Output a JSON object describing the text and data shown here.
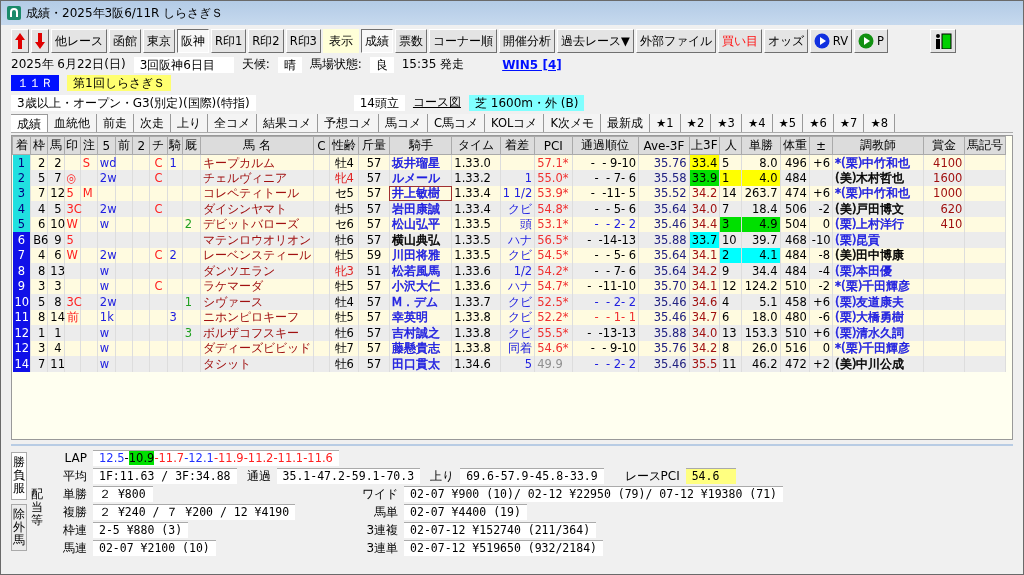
{
  "window": {
    "title": "成績・2025年3阪6/11R しらさぎＳ"
  },
  "toolbar": [
    {
      "kind": "up"
    },
    {
      "kind": "down"
    },
    {
      "kind": "button",
      "label": "他レース",
      "selected": false
    },
    {
      "kind": "button",
      "label": "函館",
      "selected": false
    },
    {
      "kind": "button",
      "label": "東京",
      "selected": false
    },
    {
      "kind": "button",
      "label": "阪神",
      "selected": true
    },
    {
      "kind": "button",
      "label": "R印1",
      "selected": false
    },
    {
      "kind": "button",
      "label": "R印2",
      "selected": false
    },
    {
      "kind": "button",
      "label": "R印3",
      "selected": false
    },
    {
      "kind": "label",
      "label": "表示"
    },
    {
      "kind": "button",
      "label": "成績",
      "selected": true
    },
    {
      "kind": "button",
      "label": "票数",
      "selected": false
    },
    {
      "kind": "button",
      "label": "コーナー順",
      "selected": false
    },
    {
      "kind": "button",
      "label": "開催分析",
      "selected": false
    },
    {
      "kind": "button",
      "label": "過去レース▼",
      "selected": false
    },
    {
      "kind": "button",
      "label": "外部ファイル",
      "selected": false
    },
    {
      "kind": "alert",
      "label": "買い目"
    },
    {
      "kind": "button",
      "label": "オッズ",
      "selected": false
    },
    {
      "kind": "play",
      "label": "RV",
      "color": "#1030e0"
    },
    {
      "kind": "play",
      "label": "P",
      "color": "#109010"
    },
    {
      "kind": "exit"
    }
  ],
  "race_info": {
    "date": "2025年 6月22日(日)",
    "meeting": "3回阪神6日目",
    "weather_label": "天候:",
    "weather": "晴",
    "track_label": "馬場状態:",
    "track": "良",
    "start": "15:35 発走",
    "win5_link": "WIN5 [4]",
    "race_number": "１１Ｒ",
    "race_name": "第1回しらさぎＳ",
    "conditions": "3歳以上・オープン・G3(別定)(国際)(特指)",
    "runners": "14頭立",
    "course_link": "コース図",
    "course": "芝 1600m・外 (B)"
  },
  "tabs": [
    {
      "label": "成績",
      "selected": true
    },
    {
      "label": "血統他",
      "selected": false
    },
    {
      "label": "前走",
      "selected": false
    },
    {
      "label": "次走",
      "selected": false
    },
    {
      "label": "上り",
      "selected": false
    },
    {
      "label": "全コメ",
      "selected": false
    },
    {
      "label": "結果コメ",
      "selected": false
    },
    {
      "label": "予想コメ",
      "selected": false
    },
    {
      "label": "馬コメ",
      "selected": false
    },
    {
      "label": "C馬コメ",
      "selected": false
    },
    {
      "label": "KOLコメ",
      "selected": false
    },
    {
      "label": "K次メモ",
      "selected": false
    },
    {
      "label": "最新成",
      "selected": false
    },
    {
      "label": "★1",
      "selected": false
    },
    {
      "label": "★2",
      "selected": false
    },
    {
      "label": "★3",
      "selected": false
    },
    {
      "label": "★4",
      "selected": false
    },
    {
      "label": "★5",
      "selected": false
    },
    {
      "label": "★6",
      "selected": false
    },
    {
      "label": "★7",
      "selected": false
    },
    {
      "label": "★8",
      "selected": false
    }
  ],
  "table": {
    "columns": [
      "着",
      "枠",
      "馬",
      "印",
      "注",
      "5",
      "前",
      "2",
      "チ",
      "騎",
      "厩",
      "馬 名",
      "C",
      "性齢",
      "斤量",
      "騎手",
      "タイム",
      "着差",
      "PCI",
      "通過順位",
      "Ave-3F",
      "上3F",
      "人",
      "単勝",
      "体重",
      "±",
      "調教師",
      "賞金",
      "馬記号"
    ],
    "rows": [
      {
        "cells": [
          {
            "text": "1",
            "color": "#20e0e0"
          },
          "2",
          "2",
          null,
          "S",
          "wd",
          null,
          null,
          "C",
          "1",
          null,
          "キープカルム",
          null,
          {
            "text": "牡4",
            "color": "#000000"
          },
          "57",
          {
            "text": "坂井瑠星",
            "color": "#2020e0",
            "focused": false
          },
          "1.33.0",
          null,
          {
            "text": "57.1*",
            "color": "#f03030"
          },
          {
            "text": "-  - 9-10",
            "color": "#000000"
          },
          "35.76",
          {
            "text": "33.4",
            "kind": "rank1"
          },
          "5",
          "8.0",
          "496",
          "+6",
          {
            "text": "*(栗)中竹和也",
            "color": "#2020e0"
          },
          "4100",
          null
        ]
      },
      {
        "cells": [
          {
            "text": "2",
            "color": "#20e0e0"
          },
          "5",
          "7",
          "◎",
          null,
          "2w",
          null,
          null,
          "C",
          null,
          null,
          "チェルヴィニア",
          null,
          {
            "text": "牝4",
            "color": "#e02020"
          },
          "57",
          {
            "text": "ルメール",
            "color": "#2020e0",
            "focused": false
          },
          "1.33.2",
          "1",
          {
            "text": "55.0*",
            "color": "#f03030"
          },
          {
            "text": "-  - 7- 6",
            "color": "#000000"
          },
          "35.58",
          {
            "text": "33.9",
            "kind": "rank3"
          },
          {
            "text": "1",
            "kind": "rank1"
          },
          {
            "text": "4.0",
            "kind": "rank1"
          },
          "484",
          null,
          {
            "text": "(美)木村哲也",
            "color": "#000000"
          },
          "1600",
          null
        ]
      },
      {
        "cells": [
          {
            "text": "3",
            "color": "#20e0e0"
          },
          "7",
          "12",
          "5",
          "M",
          null,
          null,
          null,
          null,
          null,
          null,
          "コレペティトール",
          null,
          {
            "text": "セ5",
            "color": "#000000"
          },
          "57",
          {
            "text": "井上敏樹",
            "color": "#2020e0",
            "focused": true
          },
          "1.33.4",
          "1 1/2",
          {
            "text": "53.9*",
            "color": "#f03030"
          },
          {
            "text": "-  -11- 5",
            "color": "#000000"
          },
          "35.52",
          "34.2",
          "14",
          "263.7",
          "474",
          "+6",
          {
            "text": "*(栗)中竹和也",
            "color": "#2020e0"
          },
          "1000",
          null
        ]
      },
      {
        "cells": [
          {
            "text": "4",
            "color": "#20e0e0"
          },
          "4",
          "5",
          "3C",
          null,
          "2w",
          null,
          null,
          "C",
          null,
          null,
          "ダイシンヤマト",
          null,
          {
            "text": "牡5",
            "color": "#000000"
          },
          "57",
          {
            "text": "岩田康誠",
            "color": "#2020e0",
            "focused": false
          },
          "1.33.4",
          "クビ",
          {
            "text": "54.8*",
            "color": "#f03030"
          },
          {
            "text": "-  - 5- 6",
            "color": "#000000"
          },
          "35.64",
          "34.0",
          "7",
          "18.4",
          "506",
          "-2",
          {
            "text": "(美)戸田博文",
            "color": "#000000"
          },
          "620",
          null
        ]
      },
      {
        "cells": [
          {
            "text": "5",
            "color": "#20e0e0"
          },
          "6",
          "10",
          "W",
          null,
          "w",
          null,
          null,
          null,
          null,
          "2",
          "デビットバローズ",
          null,
          {
            "text": "セ6",
            "color": "#000000"
          },
          "57",
          {
            "text": "松山弘平",
            "color": "#2020e0",
            "focused": false
          },
          "1.33.5",
          "頭",
          {
            "text": "53.1*",
            "color": "#f03030"
          },
          {
            "text": "-  - 2- 2",
            "color": "#2020e0"
          },
          "35.46",
          "34.4",
          {
            "text": "3",
            "kind": "rank3"
          },
          {
            "text": "4.9",
            "kind": "rank3"
          },
          "504",
          "0",
          {
            "text": "(栗)上村洋行",
            "color": "#2020e0"
          },
          "410",
          null
        ]
      },
      {
        "cells": [
          {
            "text": "6",
            "color": "#1010e8"
          },
          "B6",
          "9",
          "5",
          null,
          null,
          null,
          null,
          null,
          null,
          null,
          "マテンロウオリオン",
          null,
          {
            "text": "牡6",
            "color": "#000000"
          },
          "57",
          {
            "text": "横山典弘",
            "color": "#000000",
            "focused": false
          },
          "1.33.5",
          "ハナ",
          {
            "text": "56.5*",
            "color": "#f03030"
          },
          {
            "text": "-  -14-13",
            "color": "#000000"
          },
          "35.88",
          {
            "text": "33.7",
            "kind": "rank2"
          },
          "10",
          "39.7",
          "468",
          "-10",
          {
            "text": "(栗)昆貢",
            "color": "#2020e0"
          },
          null,
          null
        ]
      },
      {
        "cells": [
          {
            "text": "7",
            "color": "#1010e8"
          },
          "4",
          "6",
          "W",
          null,
          "2w",
          null,
          null,
          "C",
          "2",
          null,
          "レーベンスティール",
          null,
          {
            "text": "牡5",
            "color": "#000000"
          },
          "59",
          {
            "text": "川田将雅",
            "color": "#2020e0",
            "focused": false
          },
          "1.33.5",
          "クビ",
          {
            "text": "54.5*",
            "color": "#f03030"
          },
          {
            "text": "-  - 5- 6",
            "color": "#000000"
          },
          "35.64",
          "34.1",
          {
            "text": "2",
            "kind": "rank2"
          },
          {
            "text": "4.1",
            "kind": "rank2"
          },
          "484",
          "-8",
          {
            "text": "(美)田中博康",
            "color": "#000000"
          },
          null,
          null
        ]
      },
      {
        "cells": [
          {
            "text": "8",
            "color": "#1010e8"
          },
          "8",
          "13",
          null,
          null,
          "w",
          null,
          null,
          null,
          null,
          null,
          "ダンツエラン",
          null,
          {
            "text": "牝3",
            "color": "#e02020"
          },
          "51",
          {
            "text": "松若風馬",
            "color": "#2020e0",
            "focused": false
          },
          "1.33.6",
          "1/2",
          {
            "text": "54.2*",
            "color": "#f03030"
          },
          {
            "text": "-  - 7- 6",
            "color": "#000000"
          },
          "35.64",
          "34.2",
          "9",
          "34.4",
          "484",
          "-4",
          {
            "text": "(栗)本田優",
            "color": "#2020e0"
          },
          null,
          null
        ]
      },
      {
        "cells": [
          {
            "text": "9",
            "color": "#1010e8"
          },
          "3",
          "3",
          null,
          null,
          "w",
          null,
          null,
          "C",
          null,
          null,
          "ラケマーダ",
          null,
          {
            "text": "牡5",
            "color": "#000000"
          },
          "57",
          {
            "text": "小沢大仁",
            "color": "#2020e0",
            "focused": false
          },
          "1.33.6",
          "ハナ",
          {
            "text": "54.7*",
            "color": "#f03030"
          },
          {
            "text": "-  -11-10",
            "color": "#000000"
          },
          "35.70",
          "34.1",
          "12",
          "124.2",
          "510",
          "-2",
          {
            "text": "*(栗)千田輝彦",
            "color": "#2020e0"
          },
          null,
          null
        ]
      },
      {
        "cells": [
          {
            "text": "10",
            "color": "#1010e8"
          },
          "5",
          "8",
          "3C",
          null,
          "2w",
          null,
          null,
          null,
          null,
          "1",
          "シヴァース",
          null,
          {
            "text": "牡4",
            "color": "#000000"
          },
          "57",
          {
            "text": "M．デム",
            "color": "#2020e0",
            "focused": false
          },
          "1.33.7",
          "クビ",
          {
            "text": "52.5*",
            "color": "#f03030"
          },
          {
            "text": "-  - 2- 2",
            "color": "#2020e0"
          },
          "35.46",
          "34.6",
          "4",
          "5.1",
          "458",
          "+6",
          {
            "text": "(栗)友道康夫",
            "color": "#2020e0"
          },
          null,
          null
        ]
      },
      {
        "cells": [
          {
            "text": "11",
            "color": "#1010e8"
          },
          "8",
          "14",
          "前",
          null,
          "1k",
          null,
          null,
          null,
          "3",
          null,
          "ニホンピロキーフ",
          null,
          {
            "text": "牡5",
            "color": "#000000"
          },
          "57",
          {
            "text": "幸英明",
            "color": "#2020e0",
            "focused": false
          },
          "1.33.8",
          "クビ",
          {
            "text": "52.2*",
            "color": "#f03030"
          },
          {
            "text": "-  - 1- 1",
            "color": "#f03030"
          },
          "35.46",
          "34.7",
          "6",
          "18.0",
          "480",
          "-6",
          {
            "text": "(栗)大橋勇樹",
            "color": "#2020e0"
          },
          null,
          null
        ]
      },
      {
        "cells": [
          {
            "text": "12",
            "color": "#1010e8"
          },
          "1",
          "1",
          null,
          null,
          "w",
          null,
          null,
          null,
          null,
          "3",
          "ボルザコフスキー",
          null,
          {
            "text": "牡6",
            "color": "#000000"
          },
          "57",
          {
            "text": "吉村誠之",
            "color": "#2020e0",
            "focused": false
          },
          "1.33.8",
          "クビ",
          {
            "text": "55.5*",
            "color": "#f03030"
          },
          {
            "text": "-  -13-13",
            "color": "#000000"
          },
          "35.88",
          "34.0",
          "13",
          "153.3",
          "510",
          "+6",
          {
            "text": "(栗)清水久詞",
            "color": "#2020e0"
          },
          null,
          null
        ]
      },
      {
        "cells": [
          {
            "text": "12",
            "color": "#1010e8"
          },
          "3",
          "4",
          null,
          null,
          "w",
          null,
          null,
          null,
          null,
          null,
          "ダディーズビビッド",
          null,
          {
            "text": "牡7",
            "color": "#000000"
          },
          "57",
          {
            "text": "藤懸貴志",
            "color": "#2020e0",
            "focused": false
          },
          "1.33.8",
          "同着",
          {
            "text": "54.6*",
            "color": "#f03030"
          },
          {
            "text": "-  - 9-10",
            "color": "#000000"
          },
          "35.76",
          "34.2",
          "8",
          "26.0",
          "516",
          "0",
          {
            "text": "*(栗)千田輝彦",
            "color": "#2020e0"
          },
          null,
          null
        ]
      },
      {
        "cells": [
          {
            "text": "14",
            "color": "#1010e8"
          },
          "7",
          "11",
          null,
          null,
          "w",
          null,
          null,
          null,
          null,
          null,
          "タシット",
          null,
          {
            "text": "牡6",
            "color": "#000000"
          },
          "57",
          {
            "text": "田口貫太",
            "color": "#2020e0",
            "focused": false
          },
          "1.34.6",
          "5",
          {
            "text": "49.9",
            "color": "#909090"
          },
          {
            "text": "-  - 2- 2",
            "color": "#2020e0"
          },
          "35.46",
          "35.5",
          "11",
          "46.2",
          "472",
          "+2",
          {
            "text": "(美)中川公成",
            "color": "#000000"
          },
          null,
          null
        ]
      }
    ]
  },
  "bottom_panel": {
    "side_tabs": [
      {
        "label": "勝負服",
        "selected": true
      },
      {
        "label": "除外馬",
        "selected": false
      }
    ],
    "section_label": "配当等",
    "lap_label": "LAP",
    "lap": [
      {
        "text": "12.5",
        "color": "#2030ff",
        "highlight": false
      },
      {
        "text": "-",
        "highlight": false
      },
      {
        "text": "10.9",
        "highlight": true
      },
      {
        "text": "-11.7",
        "color": "#ff2020",
        "highlight": false
      },
      {
        "text": "-12.1",
        "color": "#2030ff",
        "highlight": false
      },
      {
        "text": "-11.9-11.2-11.1-11.6",
        "color": "#ff2020",
        "highlight": false
      }
    ],
    "average_label": "平均",
    "average": "1F:11.63 / 3F:34.88",
    "passing_label": "通過",
    "passing": "35.1-47.2-59.1-70.3",
    "final_label": "上り",
    "final": "69.6-57.9-45.8-33.9",
    "pci_label": "レースPCI",
    "pci": "54.6",
    "payouts_left": [
      {
        "label": "単勝",
        "value": "２ ¥800"
      },
      {
        "label": "複勝",
        "value": "２ ¥240 / ７ ¥200 / 12 ¥4190"
      },
      {
        "label": "枠連",
        "value": "2-5 ¥880 (3)"
      },
      {
        "label": "馬連",
        "value": "02-07 ¥2100 (10)"
      }
    ],
    "payouts_right": [
      {
        "label": "ワイド",
        "value": "02-07 ¥900 (10)/ 02-12 ¥22950 (79)/ 07-12 ¥19380 (71)"
      },
      {
        "label": "馬単",
        "value": "02-07 ¥4400 (19)"
      },
      {
        "label": "3連複",
        "value": "02-07-12 ¥152740 (211/364)"
      },
      {
        "label": "3連単",
        "value": "02-07-12 ¥519650 (932/2184)"
      }
    ]
  }
}
